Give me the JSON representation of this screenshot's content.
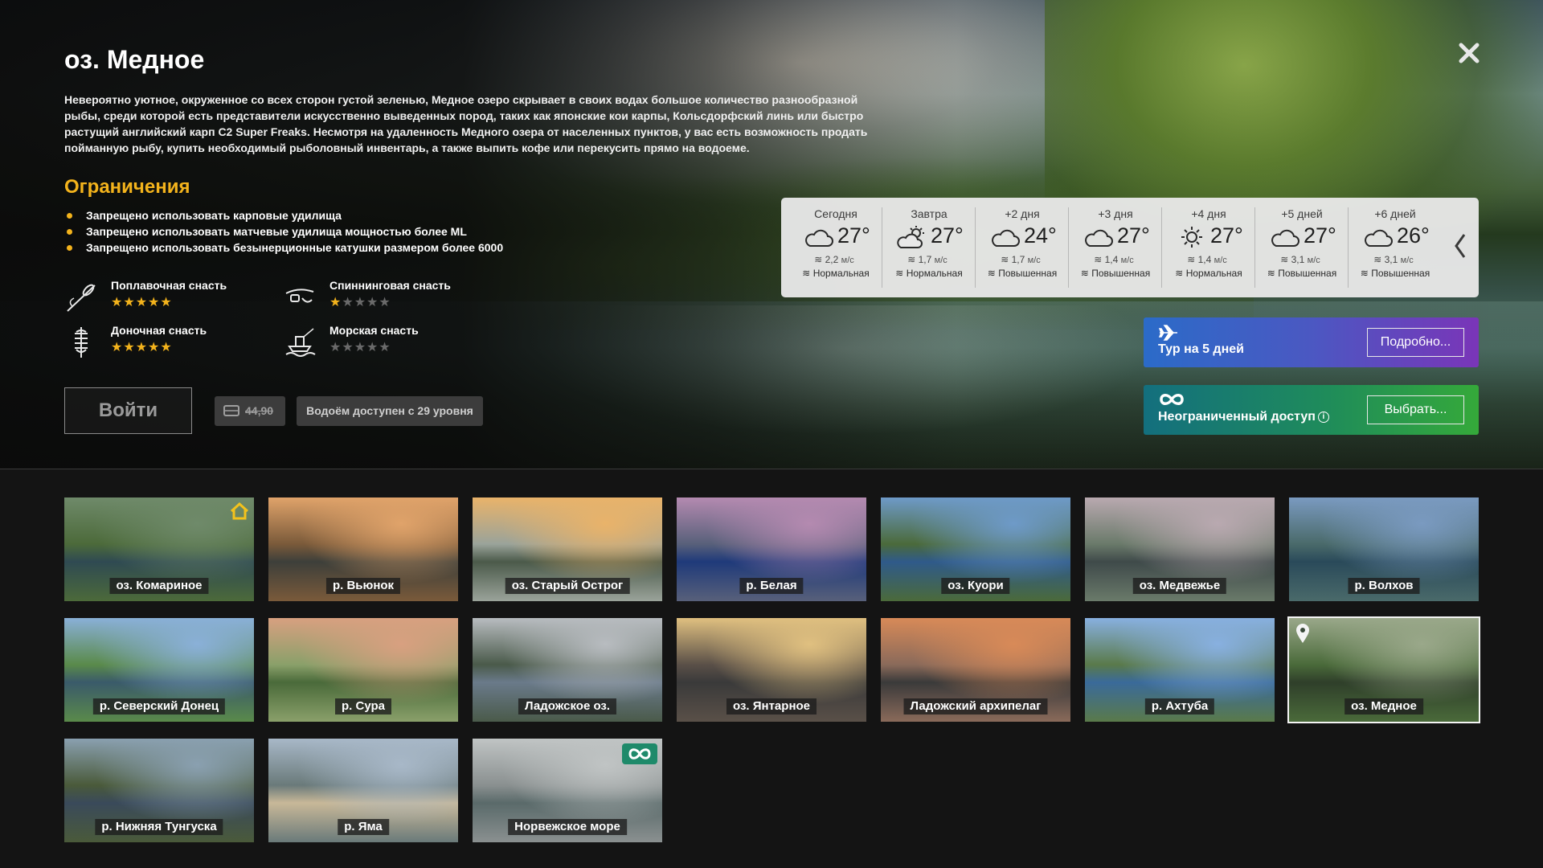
{
  "location": {
    "title": "оз. Медное",
    "description": "Невероятно уютное, окруженное со всех сторон густой зеленью, Медное озеро скрывает в своих водах большое количество разнообразной рыбы, среди которой есть представители искусственно выведенных пород, таких как японские кои карпы, Кольсдорфский линь или быстро растущий английский карп C2 Super Freaks. Несмотря на удаленность Медного озера от населенных пунктов, у вас есть возможность продать пойманную рыбу, купить необходимый рыболовный инвентарь, а также выпить кофе или перекусить прямо на водоеме."
  },
  "restrictions": {
    "title": "Ограничения",
    "items": [
      "Запрещено использовать карповые удилища",
      "Запрещено использовать матчевые удилища мощностью более ML",
      "Запрещено использовать безынерционные катушки размером более 6000"
    ]
  },
  "tackle": [
    {
      "name": "Поплавочная снасть",
      "rating": 5,
      "icon": "float-rod-icon"
    },
    {
      "name": "Спиннинговая снасть",
      "rating": 1,
      "icon": "spinning-rod-icon"
    },
    {
      "name": "Доночная снасть",
      "rating": 5,
      "icon": "bottom-rod-icon"
    },
    {
      "name": "Морская снасть",
      "rating": 0,
      "icon": "sea-fishing-icon"
    }
  ],
  "actions": {
    "enter_label": "Войти",
    "price": "44,90",
    "price_icon": "ticket-icon",
    "level_label": "Водоём доступен с 29 уровня"
  },
  "weather": [
    {
      "day": "Сегодня",
      "icon": "cloud-icon",
      "temp": "27°",
      "wind": "2,2",
      "wind_unit": "м/с",
      "pressure": "Нормальная"
    },
    {
      "day": "Завтра",
      "icon": "sun-cloud-icon",
      "temp": "27°",
      "wind": "1,7",
      "wind_unit": "м/с",
      "pressure": "Нормальная"
    },
    {
      "day": "+2 дня",
      "icon": "cloud-icon",
      "temp": "24°",
      "wind": "1,7",
      "wind_unit": "м/с",
      "pressure": "Повышенная"
    },
    {
      "day": "+3 дня",
      "icon": "cloud-icon",
      "temp": "27°",
      "wind": "1,4",
      "wind_unit": "м/с",
      "pressure": "Повышенная"
    },
    {
      "day": "+4 дня",
      "icon": "sun-icon",
      "temp": "27°",
      "wind": "1,4",
      "wind_unit": "м/с",
      "pressure": "Нормальная"
    },
    {
      "day": "+5 дней",
      "icon": "cloud-icon",
      "temp": "27°",
      "wind": "3,1",
      "wind_unit": "м/с",
      "pressure": "Повышенная"
    },
    {
      "day": "+6 дней",
      "icon": "cloud-icon",
      "temp": "26°",
      "wind": "3,1",
      "wind_unit": "м/с",
      "pressure": "Повышенная"
    }
  ],
  "promos": {
    "tour_label": "Тур на 5 дней",
    "tour_button": "Подробно...",
    "unlimited_label": "Неограниченный доступ",
    "unlimited_button": "Выбрать..."
  },
  "locations": [
    {
      "name": "оз. Комариное",
      "badge": "home-icon",
      "colors": [
        "#6f8a6a",
        "#4c6a3a",
        "#2f4a52"
      ]
    },
    {
      "name": "р. Вьюнок",
      "colors": [
        "#e0a36a",
        "#7a5a3a",
        "#3d3f3a"
      ]
    },
    {
      "name": "оз. Старый Острог",
      "colors": [
        "#e9b36a",
        "#9aa39a",
        "#4b5a4a"
      ]
    },
    {
      "name": "р. Белая",
      "colors": [
        "#b48ab0",
        "#58607a",
        "#1f3a7a"
      ]
    },
    {
      "name": "оз. Куори",
      "colors": [
        "#6e9ac8",
        "#4b6a3a",
        "#2f5a8a"
      ]
    },
    {
      "name": "оз. Медвежье",
      "colors": [
        "#b9a9b0",
        "#6a7a6a",
        "#3f4a4a"
      ]
    },
    {
      "name": "р. Волхов",
      "colors": [
        "#7a9ac0",
        "#4a6a6a",
        "#2a4a5a"
      ]
    },
    {
      "name": "р. Северский Донец",
      "colors": [
        "#8ab0d8",
        "#5a8a4a",
        "#3a5a6a"
      ]
    },
    {
      "name": "р. Сура",
      "colors": [
        "#d8a080",
        "#8aa06a",
        "#4a6a3a"
      ]
    },
    {
      "name": "Ладожское оз.",
      "colors": [
        "#b8bcc0",
        "#4a5a4a",
        "#6a7a8a"
      ]
    },
    {
      "name": "оз. Янтарное",
      "colors": [
        "#e0c080",
        "#5a5048",
        "#3a3a3a"
      ]
    },
    {
      "name": "Ладожский архипелаг",
      "colors": [
        "#d88a58",
        "#8a6a5a",
        "#3a3a3a"
      ]
    },
    {
      "name": "р. Ахтуба",
      "colors": [
        "#88b0e0",
        "#5a7a4a",
        "#3a6a9a"
      ]
    },
    {
      "name": "оз. Медное",
      "badge": "pin-icon",
      "colors": [
        "#9aa88a",
        "#4a6a3a",
        "#2f3f2a"
      ]
    },
    {
      "name": "р. Нижняя Тунгуска",
      "colors": [
        "#8aa0b0",
        "#4a5a3a",
        "#3a4a5a"
      ]
    },
    {
      "name": "р. Яма",
      "colors": [
        "#a8b8c8",
        "#6a7a7a",
        "#c8b898"
      ]
    },
    {
      "name": "Норвежское море",
      "badge": "infinity-icon",
      "colors": [
        "#c0c4c4",
        "#8a9090",
        "#5a6a6a"
      ]
    }
  ],
  "selected_location": "оз. Медное",
  "colors": {
    "accent": "#f3b31c",
    "star_off": "#6a6a6a",
    "tour_gradient": [
      "#2b6bc8",
      "#7a35b8"
    ],
    "unlimited_gradient": [
      "#136f7e",
      "#35a93a"
    ]
  }
}
